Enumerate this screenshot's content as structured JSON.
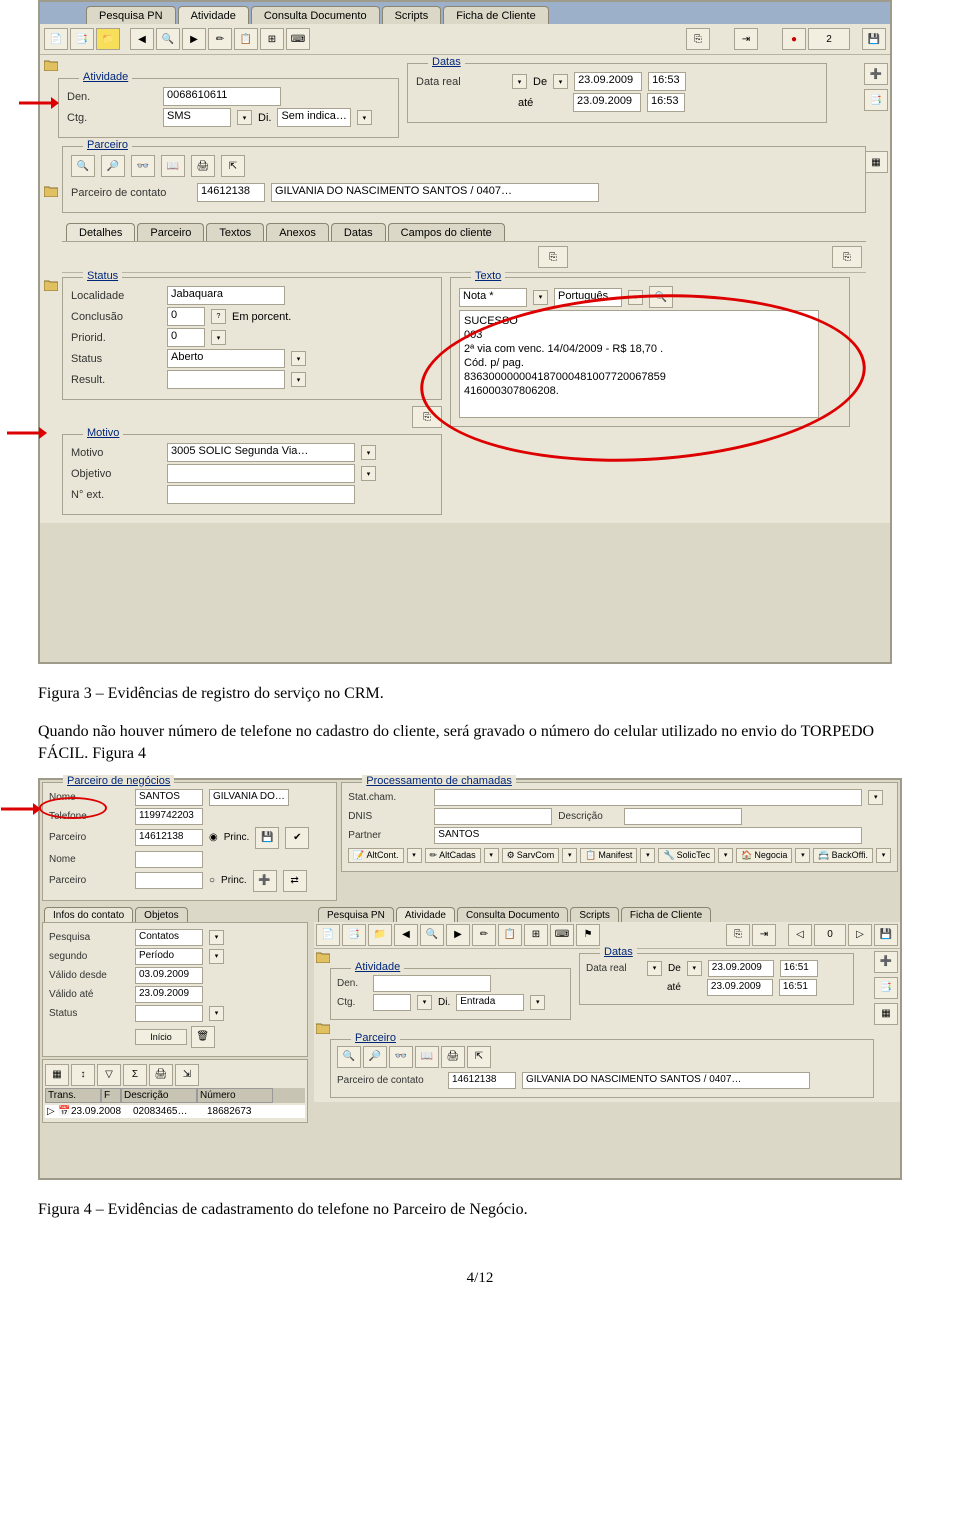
{
  "fig3": {
    "tabs": [
      "Pesquisa PN",
      "Atividade",
      "Consulta Documento",
      "Scripts",
      "Ficha de Cliente"
    ],
    "active_tab": 1,
    "toolbar_badge": "2",
    "atividade": {
      "title": "Atividade",
      "den_label": "Den.",
      "den": "0068610611",
      "ctg_label": "Ctg.",
      "ctg": "SMS",
      "di_label": "Di.",
      "di": "Sem indica…"
    },
    "datas": {
      "title": "Datas",
      "real_label": "Data real",
      "de_label": "De",
      "de_date": "23.09.2009",
      "de_time": "16:53",
      "ate_label": "até",
      "ate_date": "23.09.2009",
      "ate_time": "16:53"
    },
    "parceiro": {
      "title": "Parceiro",
      "label": "Parceiro de contato",
      "code": "14612138",
      "name": "GILVANIA DO NASCIMENTO SANTOS / 0407…"
    },
    "subtabs": [
      "Detalhes",
      "Parceiro",
      "Textos",
      "Anexos",
      "Datas",
      "Campos do cliente"
    ],
    "status": {
      "title": "Status",
      "loc_label": "Localidade",
      "loc": "Jabaquara",
      "conc_label": "Conclusão",
      "conc": "0",
      "conc_unit": "Em porcent.",
      "prior_label": "Priorid.",
      "prior": "0",
      "stat_label": "Status",
      "stat": "Aberto",
      "res_label": "Result."
    },
    "texto": {
      "title": "Texto",
      "nota_label": "Nota *",
      "lang": "Português",
      "lines": "SUCESSO\n003\n2ª via com venc. 14/04/2009 - R$ 18,70 .\nCód. p/ pag.\n836300000004187000481007720067859\n416000307806208."
    },
    "motivo": {
      "title": "Motivo",
      "mot_label": "Motivo",
      "mot_value": "3005 SOLIC Segunda Via…",
      "obj_label": "Objetivo",
      "ext_label": "N° ext."
    }
  },
  "captions": {
    "f3": "Figura 3 – Evidências de registro do serviço no CRM.",
    "body": "Quando não houver número de telefone no cadastro do cliente, será gravado o número do celular utilizado no envio do TORPEDO FÁCIL. Figura 4",
    "f4": "Figura 4 – Evidências de cadastramento do telefone no Parceiro de Negócio."
  },
  "fig4": {
    "pn": {
      "title": "Parceiro de negócios",
      "nome_label": "Nome",
      "nome1": "SANTOS",
      "nome2": "GILVANIA DO…",
      "tel_label": "Telefone",
      "tel": "1199742203",
      "parc_label": "Parceiro",
      "parc": "14612138",
      "princ": "Princ.",
      "nome2_label": "Nome",
      "parc2_label": "Parceiro"
    },
    "proc": {
      "title": "Processamento de chamadas",
      "stat_label": "Stat.cham.",
      "dnis_label": "DNIS",
      "desc_label": "Descrição",
      "partner_label": "Partner",
      "partner": "SANTOS"
    },
    "actions": [
      "AltCont.",
      "AltCadas",
      "SarvCom",
      "Manifest",
      "SolicTec",
      "Negocia",
      "BackOffi."
    ],
    "left_tabs": [
      "Infos do contato",
      "Objetos"
    ],
    "right_tabs": [
      "Pesquisa PN",
      "Atividade",
      "Consulta Documento",
      "Scripts",
      "Ficha de Cliente"
    ],
    "search": {
      "pesq_label": "Pesquisa",
      "pesq_value": "Contatos",
      "seg_label": "segundo",
      "seg_value": "Período",
      "vd_label": "Válido desde",
      "vd": "03.09.2009",
      "va_label": "Válido até",
      "va": "23.09.2009",
      "stat_label": "Status",
      "inicio": "Início"
    },
    "list": {
      "cols": [
        "Trans.",
        "F",
        "Descrição",
        "Número"
      ],
      "date": "23.09.2008",
      "desc": "02083465…",
      "num": "18682673"
    },
    "atividade": {
      "title": "Atividade",
      "den_label": "Den.",
      "ctg_label": "Ctg.",
      "di_label": "Di.",
      "di": "Entrada"
    },
    "datas": {
      "title": "Datas",
      "real_label": "Data real",
      "de_label": "De",
      "de_date": "23.09.2009",
      "de_time": "16:51",
      "ate_label": "até",
      "ate_date": "23.09.2009",
      "ate_time": "16:51"
    },
    "parceiro": {
      "title": "Parceiro",
      "label": "Parceiro de contato",
      "code": "14612138",
      "name": "GILVANIA DO NASCIMENTO SANTOS / 0407…"
    },
    "tb_badge": "0"
  },
  "page_number": "4/12"
}
